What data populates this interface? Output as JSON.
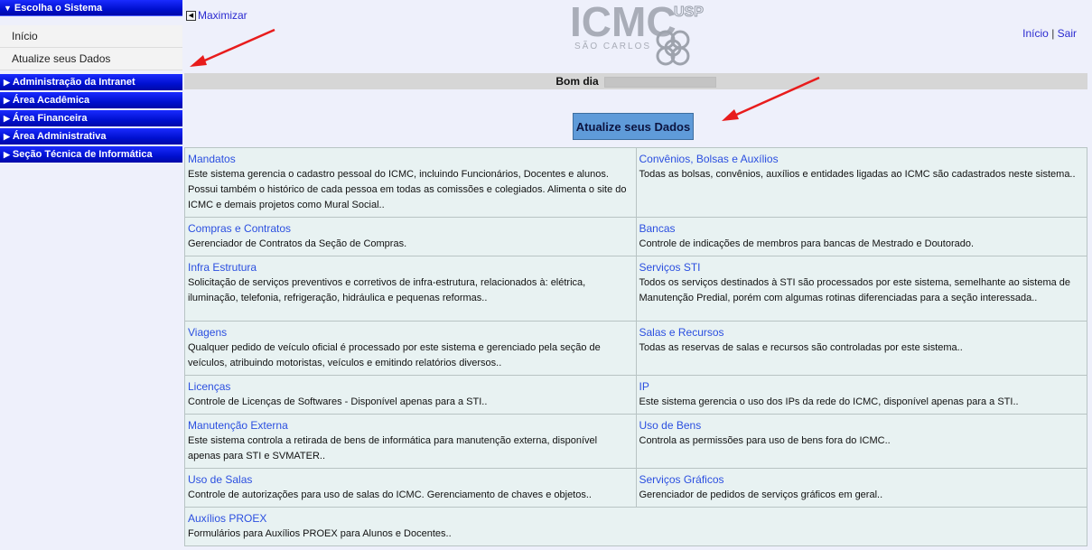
{
  "sidebar": {
    "header": "Escolha o Sistema",
    "links": [
      "Início",
      "Atualize seus Dados"
    ],
    "categories": [
      "Administração da Intranet",
      "Área Acadêmica",
      "Área Financeira",
      "Área Administrativa",
      "Seção Técnica de Informática"
    ]
  },
  "header": {
    "maximize": "Maximizar",
    "logo_main": "ICMC",
    "logo_sub": "SÃO CARLOS",
    "logo_usp": "USP",
    "link_home": "Início",
    "separator": "|",
    "link_exit": "Sair"
  },
  "greeting": "Bom dia",
  "update_button": "Atualize seus Dados",
  "systems": [
    {
      "title": "Mandatos",
      "desc": "Este sistema gerencia o cadastro pessoal do ICMC, incluindo Funcionários, Docentes e alunos. Possui também o histórico de cada pessoa em todas as comissões e colegiados. Alimenta o site do ICMC e demais projetos como Mural Social.."
    },
    {
      "title": "Convênios, Bolsas e Auxílios",
      "desc": "Todas as bolsas, convênios, auxílios e entidades ligadas ao ICMC são cadastrados neste sistema.."
    },
    {
      "title": "Compras e Contratos",
      "desc": "Gerenciador de Contratos da Seção de Compras."
    },
    {
      "title": "Bancas",
      "desc": "Controle de indicações de membros para bancas de Mestrado e Doutorado."
    },
    {
      "title": "Infra Estrutura",
      "desc": "Solicitação de serviços preventivos e corretivos de infra-estrutura, relacionados à: elétrica, iluminação, telefonia, refrigeração, hidráulica e pequenas reformas.."
    },
    {
      "title": "Serviços STI",
      "desc": "Todos os serviços destinados à STI são processados por este sistema, semelhante ao sistema de Manutenção Predial, porém com algumas rotinas diferenciadas para a seção interessada.."
    },
    {
      "title": "Viagens",
      "desc": "Qualquer pedido de veículo oficial é processado por este sistema e gerenciado pela seção de veículos, atribuindo motoristas, veículos e emitindo relatórios diversos.."
    },
    {
      "title": "Salas e Recursos",
      "desc": "Todas as reservas de salas e recursos são controladas por este sistema.."
    },
    {
      "title": "Licenças",
      "desc": "Controle de Licenças de Softwares - Disponível apenas para a STI.."
    },
    {
      "title": "IP",
      "desc": "Este sistema gerencia o uso dos IPs da rede do ICMC, disponível apenas para a STI.."
    },
    {
      "title": "Manutenção Externa",
      "desc": "Este sistema controla a retirada de bens de informática para manutenção externa, disponível apenas para STI e SVMATER.."
    },
    {
      "title": "Uso de Bens",
      "desc": "Controla as permissões para uso de bens fora do ICMC.."
    },
    {
      "title": "Uso de Salas",
      "desc": "Controle de autorizações para uso de salas do ICMC. Gerenciamento de chaves e objetos.."
    },
    {
      "title": "Serviços Gráficos",
      "desc": "Gerenciador de pedidos de serviços gráficos em geral.."
    },
    {
      "title": "Auxílios PROEX",
      "desc": "Formulários para Auxílios PROEX para Alunos e Docentes.."
    }
  ],
  "colors": {
    "sidebar_blue": "#0010d0",
    "link_blue": "#2b4fe0",
    "button_blue": "#5f9bd9",
    "annotation_red": "#e81c1c"
  },
  "icons": {
    "triangle_down": "▼",
    "triangle_right": "▶"
  }
}
